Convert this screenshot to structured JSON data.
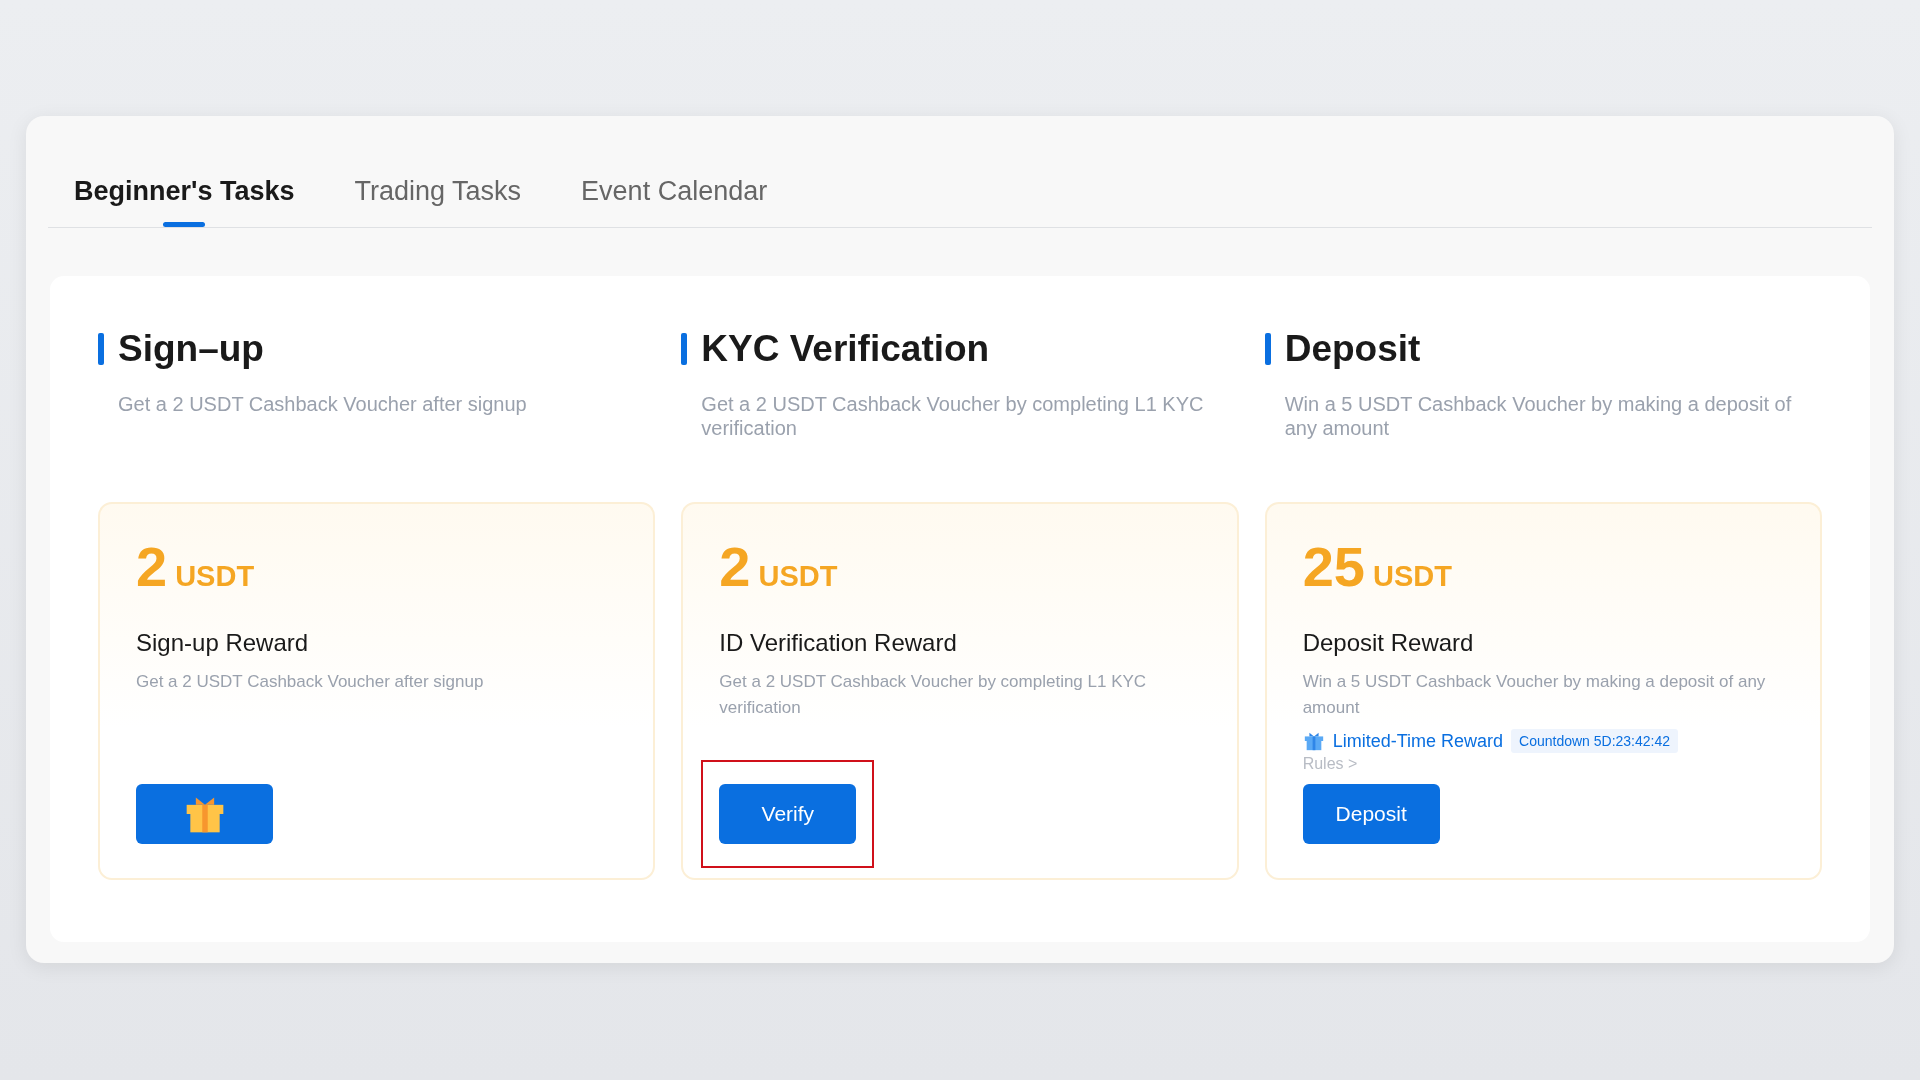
{
  "tabs": [
    {
      "label": "Beginner's Tasks",
      "selected": true
    },
    {
      "label": "Trading Tasks",
      "selected": false
    },
    {
      "label": "Event Calendar",
      "selected": false
    }
  ],
  "tasks": [
    {
      "heading": "Sign–up",
      "subtitle": "Get a 2 USDT Cashback Voucher after signup",
      "amount": "2",
      "unit": "USDT",
      "reward": "Sign-up Reward",
      "description": "Get a 2 USDT Cashback Voucher after signup",
      "button": {
        "kind": "gift",
        "highlighted": false
      }
    },
    {
      "heading": "KYC Verification",
      "subtitle": "Get a 2 USDT Cashback Voucher by completing L1 KYC verification",
      "amount": "2",
      "unit": "USDT",
      "reward": "ID Verification Reward",
      "description": "Get a 2 USDT Cashback Voucher by completing L1 KYC verification",
      "button": {
        "kind": "text",
        "label": "Verify",
        "highlighted": true
      }
    },
    {
      "heading": "Deposit",
      "subtitle": "Win a 5 USDT Cashback Voucher by making a deposit of any amount",
      "amount": "25",
      "unit": "USDT",
      "reward": "Deposit Reward",
      "description": "Win a 5 USDT Cashback Voucher by making a deposit of any amount",
      "promo": {
        "label": "Limited-Time Reward",
        "countdown": "Countdown 5D:23:42:42"
      },
      "rules": "Rules >",
      "button": {
        "kind": "text",
        "label": "Deposit",
        "highlighted": false
      }
    }
  ]
}
